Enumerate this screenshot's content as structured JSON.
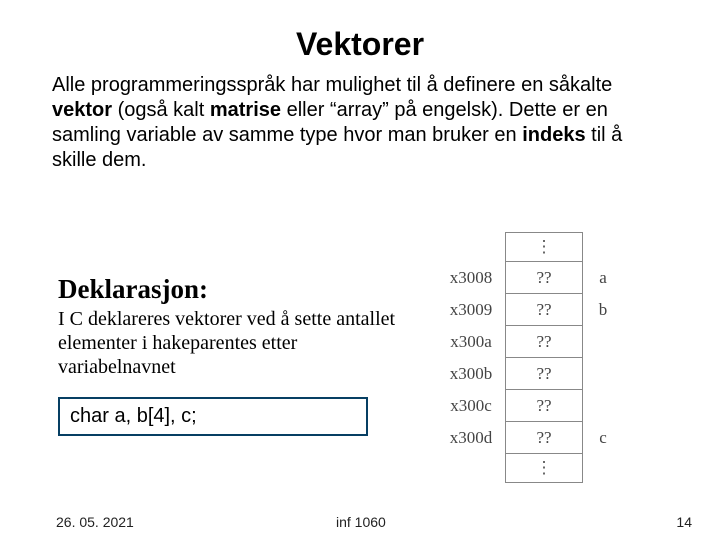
{
  "title": "Vektorer",
  "paragraph_parts": {
    "p1a": "Alle programmeringsspråk har mulighet til å definere en såkalte ",
    "p1b_bold": "vektor",
    "p1c": " (også kalt ",
    "p1d_bold": "matrise",
    "p1e": " eller “array” på engelsk). Dette er en samling variable av samme type hvor man bruker en ",
    "p1f_bold": "indeks",
    "p1g": " til å skille dem."
  },
  "subheading": "Deklarasjon:",
  "subparagraph": "I C deklareres vektorer ved å sette antallet elementer i hakeparentes etter variabelnavnet",
  "code": "char a, b[4], c;",
  "memory": {
    "rows": [
      {
        "addr": "x3008",
        "val": "??",
        "var": "a"
      },
      {
        "addr": "x3009",
        "val": "??",
        "var": "b"
      },
      {
        "addr": "x300a",
        "val": "??",
        "var": ""
      },
      {
        "addr": "x300b",
        "val": "??",
        "var": ""
      },
      {
        "addr": "x300c",
        "val": "??",
        "var": ""
      },
      {
        "addr": "x300d",
        "val": "??",
        "var": "c"
      }
    ]
  },
  "footer": {
    "date": "26. 05. 2021",
    "course": "inf 1060",
    "page": "14"
  },
  "vdots": "⋮"
}
